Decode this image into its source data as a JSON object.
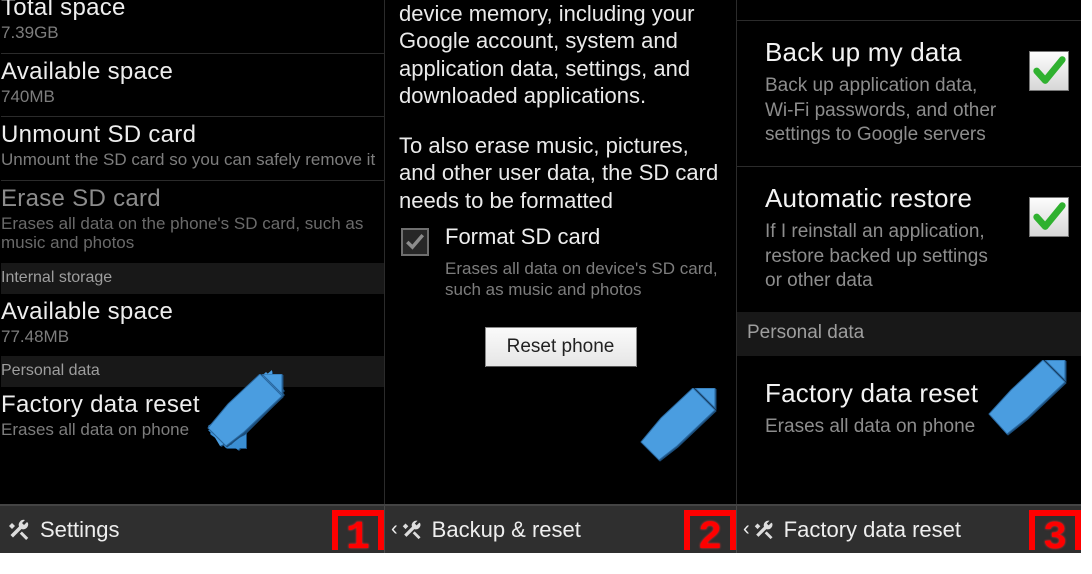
{
  "panel1": {
    "total_space": {
      "title": "Total space",
      "value": "7.39GB"
    },
    "avail1": {
      "title": "Available space",
      "value": "740MB"
    },
    "unmount": {
      "title": "Unmount SD card",
      "sub": "Unmount the SD card so you can safely remove it"
    },
    "erase": {
      "title": "Erase SD card",
      "sub": "Erases all data on the phone's SD card, such as music and photos"
    },
    "hdr_internal": "Internal storage",
    "avail2": {
      "title": "Available space",
      "value": "77.48MB"
    },
    "hdr_personal": "Personal data",
    "factory": {
      "title": "Factory data reset",
      "sub": "Erases all data on phone"
    }
  },
  "panel2": {
    "para1": "All data will be erased from device memory, including your Google account, system and application data, settings, and downloaded applications.",
    "para2": "To also erase music, pictures, and other user data, the SD card needs to be formatted",
    "format": {
      "title": "Format SD card",
      "sub": "Erases all data on device's SD card, such as music and photos"
    },
    "reset_btn": "Reset phone"
  },
  "panel3": {
    "backup": {
      "title": "Back up my data",
      "sub": "Back up application data, Wi-Fi passwords, and other settings to Google servers"
    },
    "auto": {
      "title": "Automatic restore",
      "sub": "If I reinstall an application, restore backed up settings or other data"
    },
    "hdr_personal": "Personal data",
    "factory": {
      "title": "Factory data reset",
      "sub": "Erases all data on phone"
    }
  },
  "bottom": {
    "s1": "Settings",
    "s2": "Backup & reset",
    "s3": "Factory data reset",
    "n1": "1",
    "n2": "2",
    "n3": "3"
  },
  "colors": {
    "arrow": "#3b8fd4"
  }
}
